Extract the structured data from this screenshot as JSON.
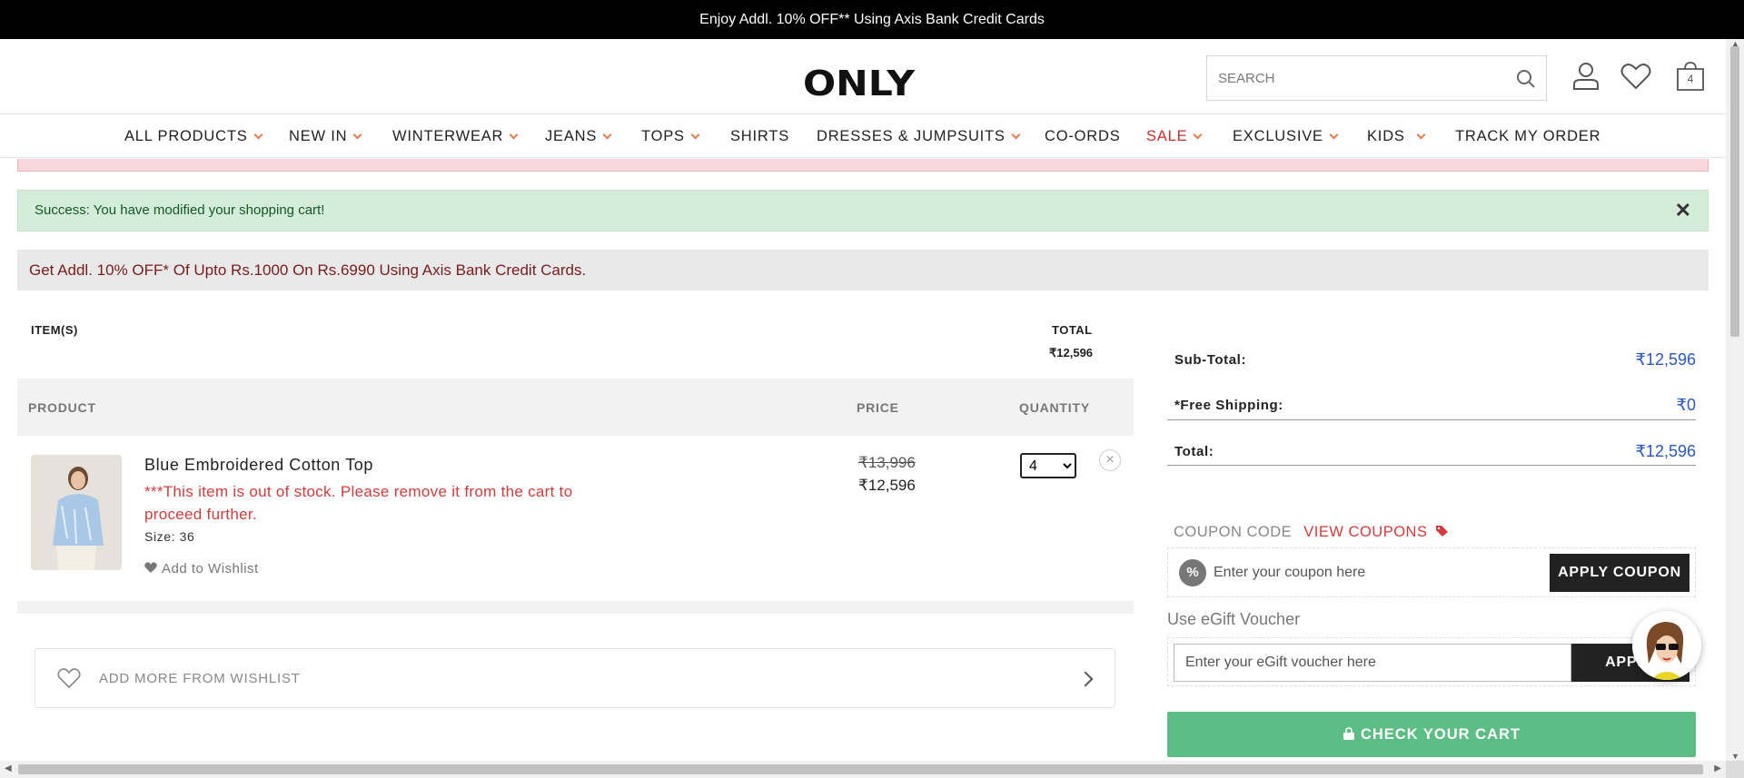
{
  "topbar": {
    "text": "Enjoy Addl. 10% OFF** Using Axis Bank Credit Cards"
  },
  "header": {
    "logo": "ONLY",
    "search_placeholder": "SEARCH",
    "cart_count": "4",
    "icons": [
      "search-icon",
      "user-icon",
      "heart-icon",
      "bag-icon"
    ]
  },
  "nav": {
    "items": [
      {
        "label": "ALL PRODUCTS",
        "dropdown": true
      },
      {
        "label": "NEW IN",
        "dropdown": true
      },
      {
        "label": "WINTERWEAR",
        "dropdown": true
      },
      {
        "label": "JEANS",
        "dropdown": true
      },
      {
        "label": "TOPS",
        "dropdown": true
      },
      {
        "label": "SHIRTS",
        "dropdown": false
      },
      {
        "label": "DRESSES & JUMPSUITS",
        "dropdown": true
      },
      {
        "label": "CO-ORDS",
        "dropdown": false
      },
      {
        "label": "SALE",
        "dropdown": true
      },
      {
        "label": "EXCLUSIVE",
        "dropdown": true
      },
      {
        "label": "KIDS",
        "dropdown": true
      },
      {
        "label": "TRACK MY ORDER",
        "dropdown": false
      }
    ]
  },
  "alerts": {
    "success": "Success: You have modified your shopping cart!",
    "close_glyph": "✕",
    "promo": "Get Addl. 10% OFF* Of Upto Rs.1000 On Rs.6990 Using Axis Bank Credit Cards."
  },
  "cart": {
    "items_label": "ITEM(S)",
    "total_label": "TOTAL",
    "total_value": "₹12,596",
    "columns": {
      "product": "PRODUCT",
      "price": "PRICE",
      "quantity": "QUANTITY"
    },
    "item": {
      "name": "Blue Embroidered Cotton Top",
      "stock_warning": "***This item is out of stock. Please remove it from the cart to proceed further.",
      "size": "Size: 36",
      "wishlist_label": "Add to Wishlist",
      "price_old": "₹13,996",
      "price_new": "₹12,596",
      "quantity": "4",
      "remove_glyph": "×"
    },
    "wishlist_cta": "ADD MORE FROM WISHLIST"
  },
  "summary": {
    "subtotal_label": "Sub-Total:",
    "subtotal_value": "₹12,596",
    "shipping_label": "*Free Shipping:",
    "shipping_value": "₹0",
    "total_label": "Total:",
    "total_value": "₹12,596"
  },
  "coupon": {
    "label": "COUPON CODE",
    "view_label": "VIEW COUPONS",
    "badge": "%",
    "placeholder": "Enter your coupon here",
    "apply_label": "APPLY COUPON"
  },
  "egift": {
    "label": "Use eGift Voucher",
    "placeholder": "Enter your eGift voucher here",
    "apply_label": "APPLY"
  },
  "checkout": {
    "label": "CHECK YOUR CART"
  },
  "colors": {
    "accent_orange": "#e57c4a",
    "sale_red": "#d22b2b",
    "price_blue": "#2a56c6",
    "checkout_green": "#5cbd85"
  }
}
